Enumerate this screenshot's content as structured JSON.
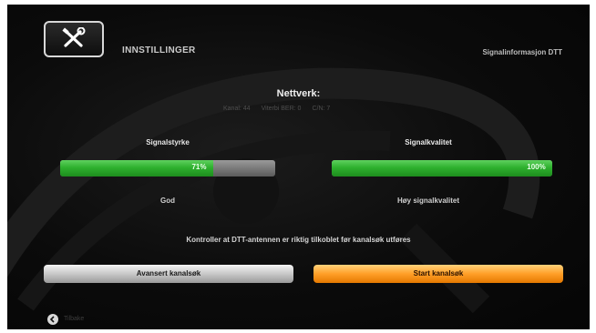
{
  "header": {
    "title": "INNSTILLINGER",
    "right_text": "Signalinformasjon DTT",
    "icon": "tools-icon"
  },
  "network": {
    "title": "Nettverk:",
    "kanal": "Kanal: 44",
    "ber": "Viterbi BER: 0",
    "cn": "C/N: 7"
  },
  "strength": {
    "label": "Signalstyrke",
    "value_text": "71%",
    "value": 0.71,
    "status": "God"
  },
  "quality": {
    "label": "Signalkvalitet",
    "value_text": "100%",
    "value": 1.0,
    "status": "Høy signalkvalitet"
  },
  "hint": "Kontroller at DTT-antennen er riktig tilkoblet før kanalsøk utføres",
  "buttons": {
    "advanced": "Avansert kanalsøk",
    "start": "Start kanalsøk"
  },
  "footer": {
    "back_label": "Tilbake",
    "back_icon": "back-arrow-icon"
  },
  "colors": {
    "bar_green": "#2fb12f",
    "start_orange": "#ff9f28",
    "advanced_gray": "#c8c8c8",
    "background": "#0b0b0b"
  }
}
